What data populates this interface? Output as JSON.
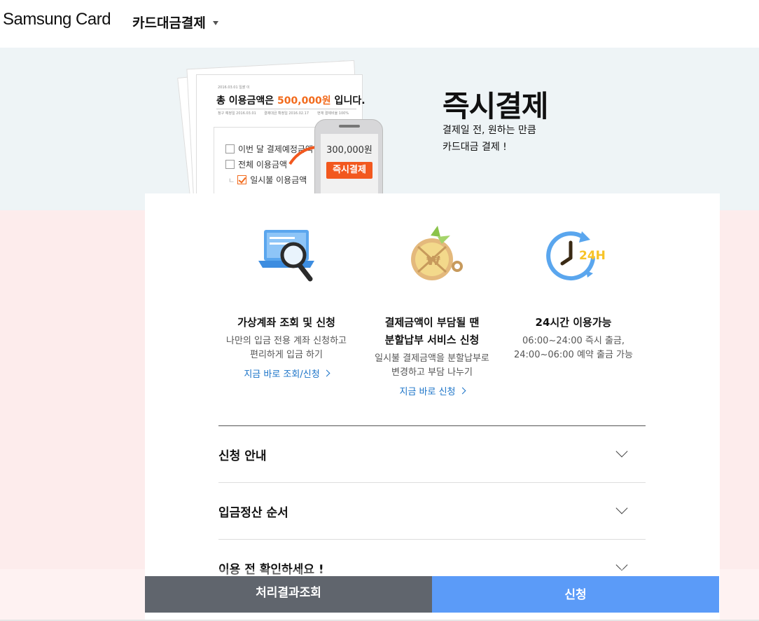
{
  "header": {
    "logo": "Samsung Card",
    "menu_title": "카드대금결제"
  },
  "hero": {
    "title": "즉시결제",
    "desc_line1": "결제일 전, 원하는 만큼",
    "desc_line2": "카드대금 결제 !",
    "paper": {
      "small_top": "2016.03.01 일괄 이",
      "total_prefix": "총 이용금액은 ",
      "total_amount": "500,000원",
      "total_suffix": " 입니다.",
      "meta_1": "청구 예정일 2016.03.01",
      "meta_2": "결제대금 확정일 2016.02.17",
      "meta_3": "현재 결제비율 100%",
      "option_1": "이번 달 결제예정금액",
      "option_2": "전체 이용금액",
      "option_3": "일시불 이용금액"
    },
    "phone": {
      "amount": "300,000원",
      "button": "즉시결제"
    }
  },
  "features": [
    {
      "icon": "laptop-search-icon",
      "title_line1": "가상계좌 조회 및 신청",
      "title_line2": "",
      "desc_line1": "나만의 입금 전용 계좌 신청하고",
      "desc_line2": "편리하게 입금 하기",
      "link": "지금 바로 조회/신청"
    },
    {
      "icon": "split-pizza-icon",
      "title_line1": "결제금액이 부담될 땐",
      "title_line2": "분할납부 서비스 신청",
      "desc_line1": "일시불 결제금액을 분할납부로",
      "desc_line2": "변경하고 부담 나누기",
      "link": "지금 바로 신청"
    },
    {
      "icon": "clock-24h-icon",
      "title_line1": "24시간 이용가능",
      "title_line2": "",
      "desc_line1": "06:00~24:00 즉시 출금,",
      "desc_line2": "24:00~06:00 예약 출금 가능",
      "link": ""
    }
  ],
  "accordion": [
    {
      "label": "신청 안내"
    },
    {
      "label": "입금정산 순서"
    },
    {
      "label": "이용 전 확인하세요 !"
    }
  ],
  "bottom": {
    "result_button": "처리결과조회",
    "apply_button": "신청"
  },
  "colors": {
    "accent_orange": "#f2581e",
    "apply_blue": "#5b9bf8",
    "result_gray": "#60656d",
    "link_blue": "#1a73c8"
  }
}
